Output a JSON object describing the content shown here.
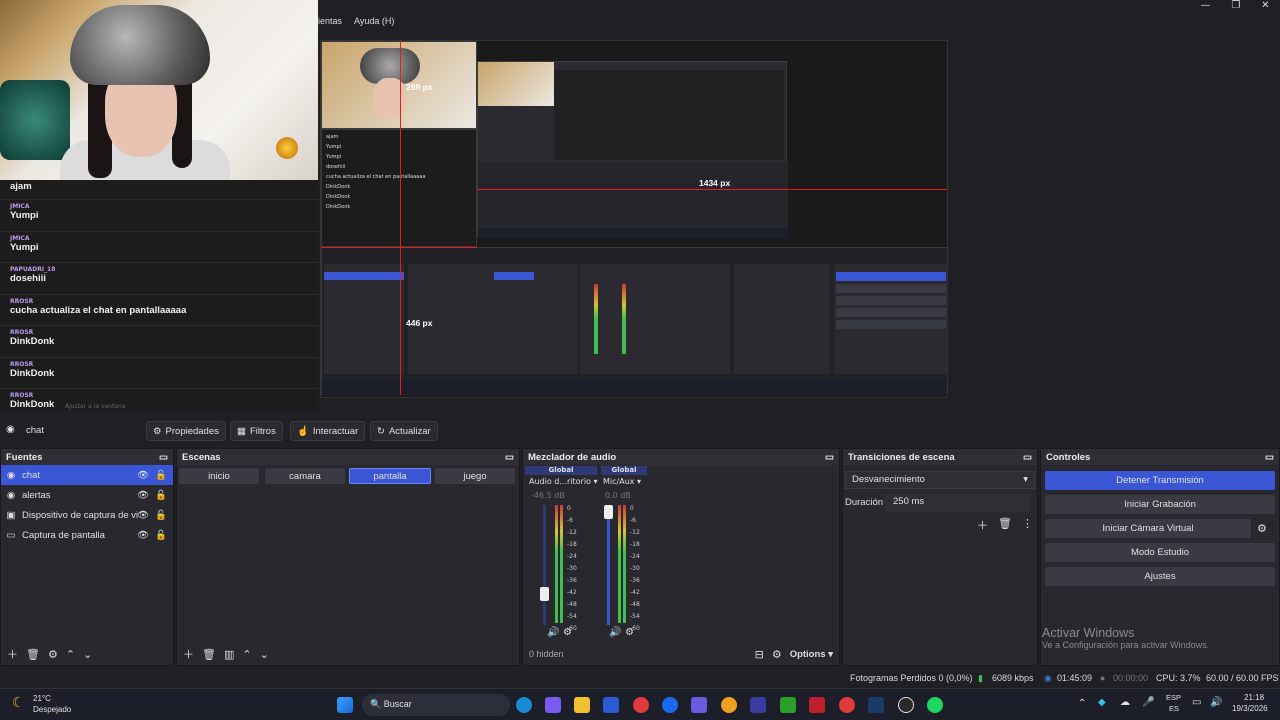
{
  "menu": {
    "items": [
      "ientas",
      "Ayuda (H)"
    ]
  },
  "window_controls": {
    "minimize": "—",
    "maximize": "❐",
    "close": "✕"
  },
  "chat": {
    "messages": [
      {
        "user": "",
        "text": "ajam"
      },
      {
        "user": "JMICA",
        "text": "Yumpi"
      },
      {
        "user": "JMICA",
        "text": "Yumpi"
      },
      {
        "user": "PAPUADRI_18",
        "text": "dosehiii"
      },
      {
        "user": "RROSR",
        "text": "cucha actualiza el chat en pantallaaaaa"
      },
      {
        "user": "RROSR",
        "text": "DinkDonk"
      },
      {
        "user": "RROSR",
        "text": "DinkDonk"
      },
      {
        "user": "RROSR",
        "text": "DinkDonk"
      }
    ],
    "adjust_hint": "Ajustar a la ventana"
  },
  "preview": {
    "label_top": "269 px",
    "label_right": "1434 px",
    "label_left": "446 px"
  },
  "source_toolbar": {
    "selected_source": "chat",
    "properties": "Propiedades",
    "filters": "Filtros",
    "interact": "Interactuar",
    "refresh": "Actualizar"
  },
  "sources": {
    "title": "Fuentes",
    "items": [
      {
        "label": "chat",
        "selected": true
      },
      {
        "label": "alertas",
        "selected": false
      },
      {
        "label": "Dispositivo de captura de vi",
        "selected": false
      },
      {
        "label": "Captura de pantalla",
        "selected": false
      }
    ]
  },
  "scenes": {
    "title": "Escenas",
    "items": [
      {
        "label": "inicio",
        "selected": false
      },
      {
        "label": "camara",
        "selected": false
      },
      {
        "label": "pantalla",
        "selected": true
      },
      {
        "label": "juego",
        "selected": false
      }
    ]
  },
  "mixer": {
    "title": "Mezclador de audio",
    "channels": [
      {
        "name": "Global",
        "device": "Audio d...ritorio",
        "db": "-46.5 dB"
      },
      {
        "name": "Global",
        "device": "Mic/Aux",
        "db": "0.0 dB"
      }
    ],
    "scale": [
      "0",
      "-6",
      "-12",
      "-18",
      "-24",
      "-30",
      "-36",
      "-42",
      "-48",
      "-54",
      "-60"
    ],
    "hidden": "0 hidden",
    "options": "Options"
  },
  "transitions": {
    "title": "Transiciones de escena",
    "selected": "Desvanecimiento",
    "duration_label": "Duración",
    "duration_value": "250 ms"
  },
  "controls": {
    "title": "Controles",
    "buttons": [
      "Detener Transmisión",
      "Iniciar Grabación",
      "Iniciar Cámara Virtual",
      "Modo Estudio",
      "Ajustes"
    ]
  },
  "watermark": {
    "title": "Activar Windows",
    "subtitle": "Ve a Configuración para activar Windows."
  },
  "status": {
    "dropped": "Fotogramas Perdidos 0 (0,0%)",
    "bitrate": "6089 kbps",
    "live_time": "01:45:09",
    "rec_time": "00:00:00",
    "cpu": "CPU: 3.7%",
    "fps": "60.00 / 60.00 FPS"
  },
  "taskbar": {
    "weather_temp": "21°C",
    "weather_desc": "Despejado",
    "search": "Buscar",
    "lang": "ESP",
    "lang2": "ES",
    "time": "21:18",
    "date": "19/3/2026"
  },
  "colors": {
    "accent": "#3a56d4",
    "meter_green": "#3fbf4f",
    "meter_yellow": "#d4c23a",
    "meter_red": "#c93a3a"
  }
}
